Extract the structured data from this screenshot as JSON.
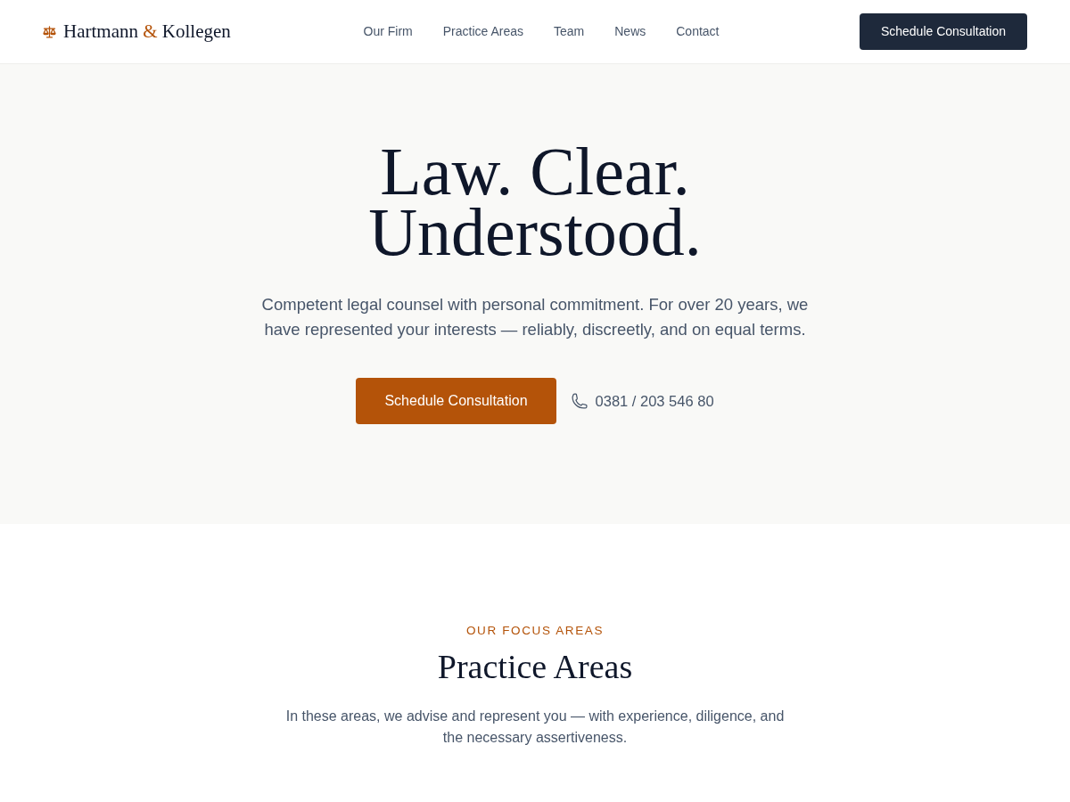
{
  "header": {
    "logo": {
      "parts": [
        {
          "text": "Hartmann",
          "accent": false
        },
        {
          "text": "&",
          "accent": true
        },
        {
          "text": "Kollegen",
          "accent": false
        }
      ]
    },
    "nav": [
      "Our Firm",
      "Practice Areas",
      "Team",
      "News",
      "Contact"
    ],
    "cta": "Schedule Consultation"
  },
  "hero": {
    "headline": "Law. Clear. Understood.",
    "lead": "Competent legal counsel with personal commitment. For over 20 years, we have represented your interests — reliably, discreetly, and on equal terms.",
    "cta": "Schedule Consultation",
    "phone": "0381 / 203 546 80"
  },
  "practice_section": {
    "eyebrow": "OUR FOCUS AREAS",
    "title": "Practice Areas",
    "intro": "In these areas, we advise and represent you — with experience, diligence, and the necessary assertiveness."
  }
}
